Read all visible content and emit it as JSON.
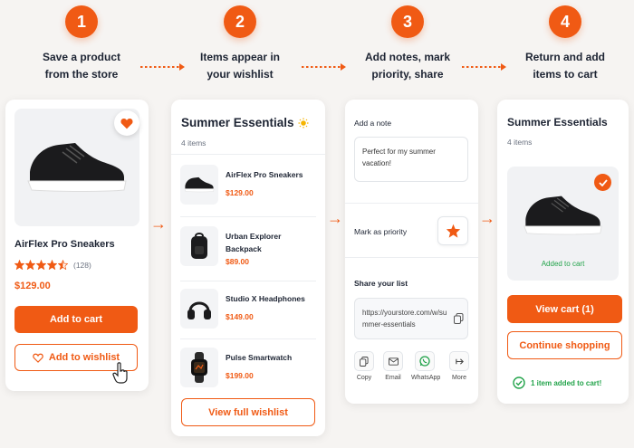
{
  "steps": [
    {
      "number": "1",
      "text": "Save a product\nfrom the store"
    },
    {
      "number": "2",
      "text": "Items appear in\nyour wishlist"
    },
    {
      "number": "3",
      "text": "Add notes, mark\npriority, share"
    },
    {
      "number": "4",
      "text": "Return and add\nitems to cart"
    }
  ],
  "product": {
    "name": "AirFlex Pro Sneakers",
    "rating_value": 4.5,
    "rating_count": "(128)",
    "price": "$129.00",
    "add_to_cart": "Add to cart",
    "add_to_wishlist": "Add to wishlist"
  },
  "wishlist": {
    "title": "Summer Essentials",
    "count": "4 items",
    "items": [
      {
        "name": "AirFlex Pro Sneakers",
        "price": "$129.00"
      },
      {
        "name": "Urban Explorer Backpack",
        "price": "$89.00"
      },
      {
        "name": "Studio X Headphones",
        "price": "$149.00"
      },
      {
        "name": "Pulse Smartwatch",
        "price": "$199.00"
      }
    ],
    "view_full": "View full wishlist"
  },
  "notes": {
    "add_note_label": "Add a note",
    "note_text": "Perfect for my summer vacation!",
    "priority_label": "Mark as priority",
    "share_label": "Share your list",
    "share_url": "https://yourstore.com/w/summer-essentials",
    "share_options": [
      {
        "label": "Copy"
      },
      {
        "label": "Email"
      },
      {
        "label": "WhatsApp"
      },
      {
        "label": "More"
      }
    ]
  },
  "cart": {
    "title": "Summer Essentials",
    "count": "4 items",
    "added_label": "Added to cart",
    "view_cart": "View cart (1)",
    "continue": "Continue shopping",
    "confirmation": "1 item added to cart!"
  },
  "colors": {
    "accent": "#f05a14",
    "success": "#22a34a"
  }
}
